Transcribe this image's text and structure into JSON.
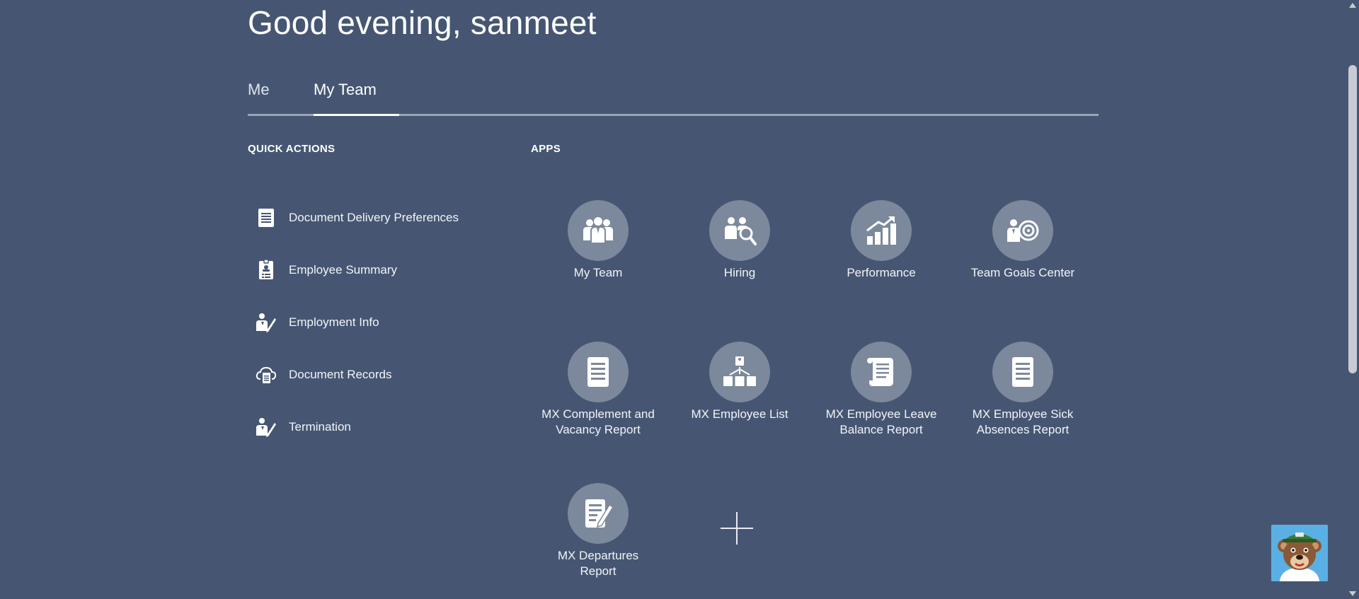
{
  "greeting": "Good evening, sanmeet",
  "tabs": [
    {
      "label": "Me",
      "active": false
    },
    {
      "label": "My Team",
      "active": true
    }
  ],
  "quick_actions": {
    "title": "QUICK ACTIONS",
    "items": [
      {
        "label": "Document Delivery Preferences",
        "icon": "document-list-icon"
      },
      {
        "label": "Employee Summary",
        "icon": "employee-badge-icon"
      },
      {
        "label": "Employment Info",
        "icon": "person-edit-icon"
      },
      {
        "label": "Document Records",
        "icon": "cloud-document-icon"
      },
      {
        "label": "Termination",
        "icon": "person-edit-icon"
      }
    ]
  },
  "apps": {
    "title": "APPS",
    "items": [
      {
        "label": "My Team",
        "icon": "team-group-icon"
      },
      {
        "label": "Hiring",
        "icon": "hiring-search-icon"
      },
      {
        "label": "Performance",
        "icon": "performance-chart-icon"
      },
      {
        "label": "Team Goals Center",
        "icon": "goals-target-icon"
      },
      {
        "label": "MX Complement and Vacancy Report",
        "icon": "report-document-icon"
      },
      {
        "label": "MX Employee List",
        "icon": "org-hierarchy-icon"
      },
      {
        "label": "MX Employee Leave Balance Report",
        "icon": "scroll-document-icon"
      },
      {
        "label": "MX Employee Sick Absences Report",
        "icon": "report-document-icon"
      },
      {
        "label": "MX Departures Report",
        "icon": "document-edit-icon"
      }
    ]
  },
  "colors": {
    "background": "#465672",
    "app_circle": "#7c889c",
    "tab_line": "#9aa5b6"
  }
}
